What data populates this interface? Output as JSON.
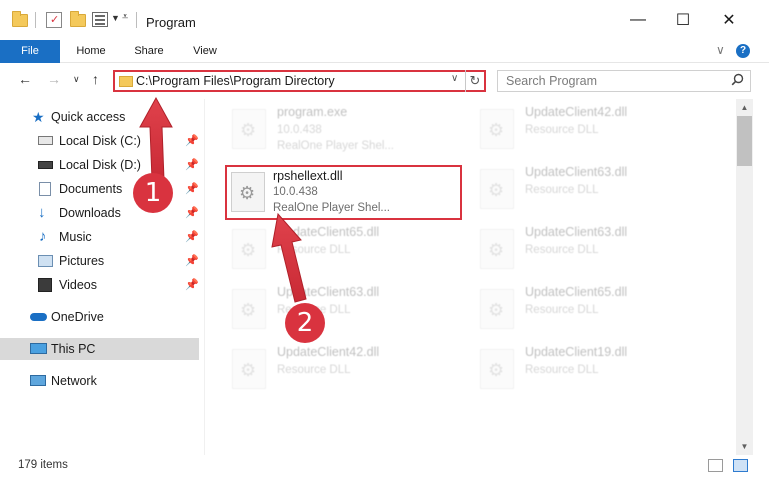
{
  "window": {
    "title": "Program",
    "minimize": "—",
    "maximize": "☐",
    "close": "✕"
  },
  "ribbon": {
    "tabs": [
      "File",
      "Home",
      "Share",
      "View"
    ],
    "help": "?"
  },
  "address": {
    "path": "C:\\Program Files\\Program Directory",
    "dropdown": "∨",
    "refresh": "↻"
  },
  "search": {
    "placeholder": "Search Program"
  },
  "sidebar": {
    "items": [
      {
        "label": "Quick access",
        "icon": "star-icon",
        "pinned": false
      },
      {
        "label": "Local Disk (C:)",
        "icon": "drive-icon",
        "pinned": true
      },
      {
        "label": "Local Disk (D:)",
        "icon": "drive-icon",
        "pinned": true
      },
      {
        "label": "Documents",
        "icon": "documents-icon",
        "pinned": true
      },
      {
        "label": "Downloads",
        "icon": "download-icon",
        "pinned": true
      },
      {
        "label": "Music",
        "icon": "music-icon",
        "pinned": true
      },
      {
        "label": "Pictures",
        "icon": "pictures-icon",
        "pinned": true
      },
      {
        "label": "Videos",
        "icon": "videos-icon",
        "pinned": true
      },
      {
        "label": "OneDrive",
        "icon": "cloud-icon",
        "pinned": false
      },
      {
        "label": "This PC",
        "icon": "computer-icon",
        "pinned": false,
        "selected": true
      },
      {
        "label": "Network",
        "icon": "network-icon",
        "pinned": false
      }
    ]
  },
  "files": [
    {
      "name": "program.exe",
      "line1": "10.0.438",
      "line2": "RealOne Player Shel...",
      "faded": true
    },
    {
      "name": "UpdateClient42.dll",
      "line1": "Resource DLL",
      "line2": "",
      "faded": true
    },
    {
      "name": "rpshellext.dll",
      "line1": "10.0.438",
      "line2": "RealOne Player Shel...",
      "faded": false
    },
    {
      "name": "UpdateClient63.dll",
      "line1": "Resource DLL",
      "line2": "",
      "faded": true
    },
    {
      "name": "UpdateClient65.dll",
      "line1": "Resource DLL",
      "line2": "",
      "faded": true
    },
    {
      "name": "UpdateClient63.dll",
      "line1": "Resource DLL",
      "line2": "",
      "faded": true
    },
    {
      "name": "UpdateClient63.dll",
      "line1": "Resource DLL",
      "line2": "",
      "faded": true
    },
    {
      "name": "UpdateClient65.dll",
      "line1": "Resource DLL",
      "line2": "",
      "faded": true
    },
    {
      "name": "UpdateClient42.dll",
      "line1": "Resource DLL",
      "line2": "",
      "faded": true
    },
    {
      "name": "UpdateClient19.dll",
      "line1": "Resource DLL",
      "line2": "",
      "faded": true
    }
  ],
  "status": {
    "count": "179 items"
  },
  "callouts": [
    "1",
    "2"
  ],
  "colors": {
    "accent": "#1a6fc4",
    "highlight": "#d9333f"
  }
}
